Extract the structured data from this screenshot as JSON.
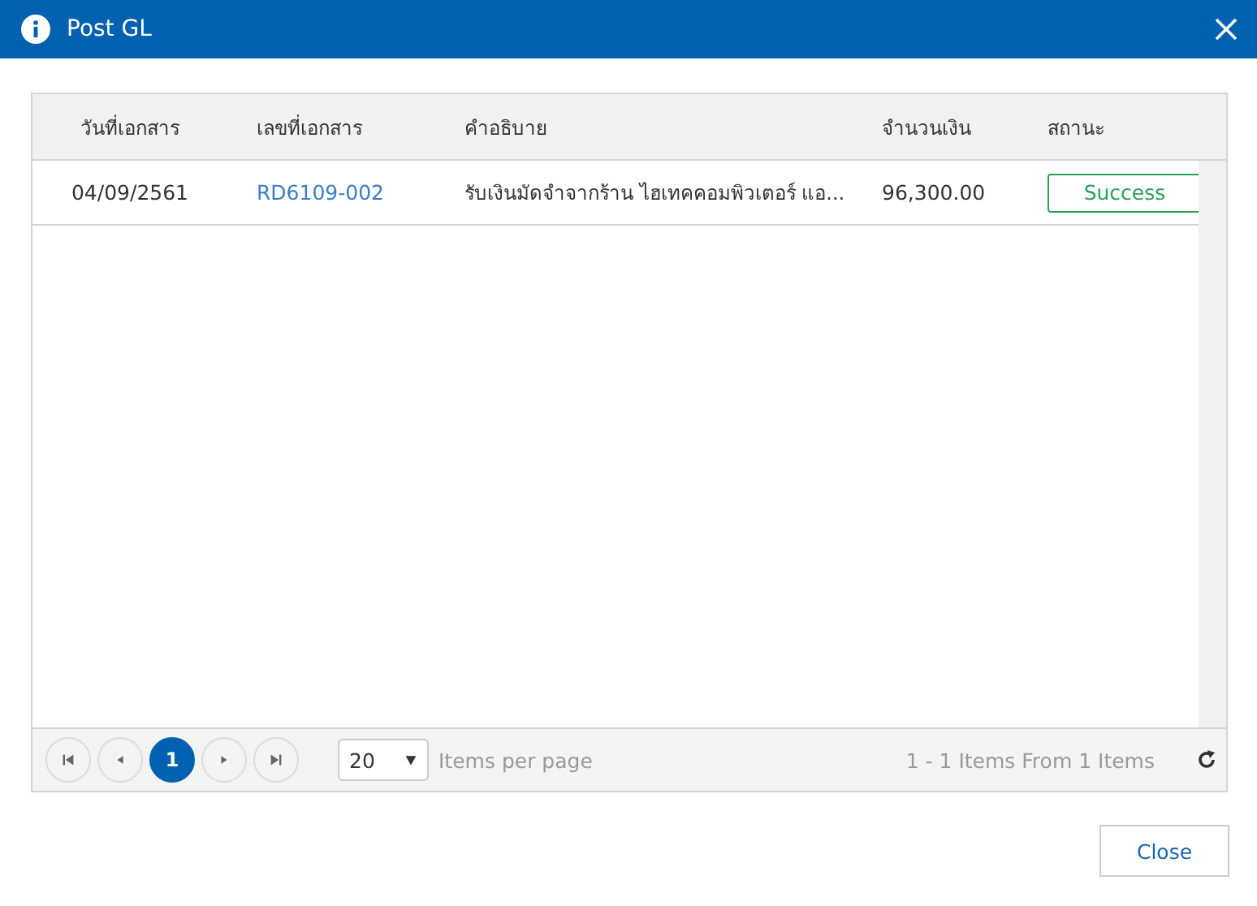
{
  "window": {
    "title": "Post GL"
  },
  "table": {
    "columns": [
      "วันที่เอกสาร",
      "เลขที่เอกสาร",
      "คำอธิบาย",
      "จำนวนเงิน",
      "สถานะ"
    ],
    "rows": [
      {
        "date": "04/09/2561",
        "doc_no": "RD6109-002",
        "description": "รับเงินมัดจำจากร้าน ไฮเทคคอมพิวเตอร์ แอ...",
        "amount": "96,300.00",
        "status": "Success"
      }
    ]
  },
  "pager": {
    "pages": [
      {
        "label": "1",
        "selected": true
      }
    ],
    "page_size": "20",
    "page_size_label": "Items per page",
    "summary": "1 - 1 Items From 1 Items"
  },
  "buttons": [
    "Close"
  ]
}
